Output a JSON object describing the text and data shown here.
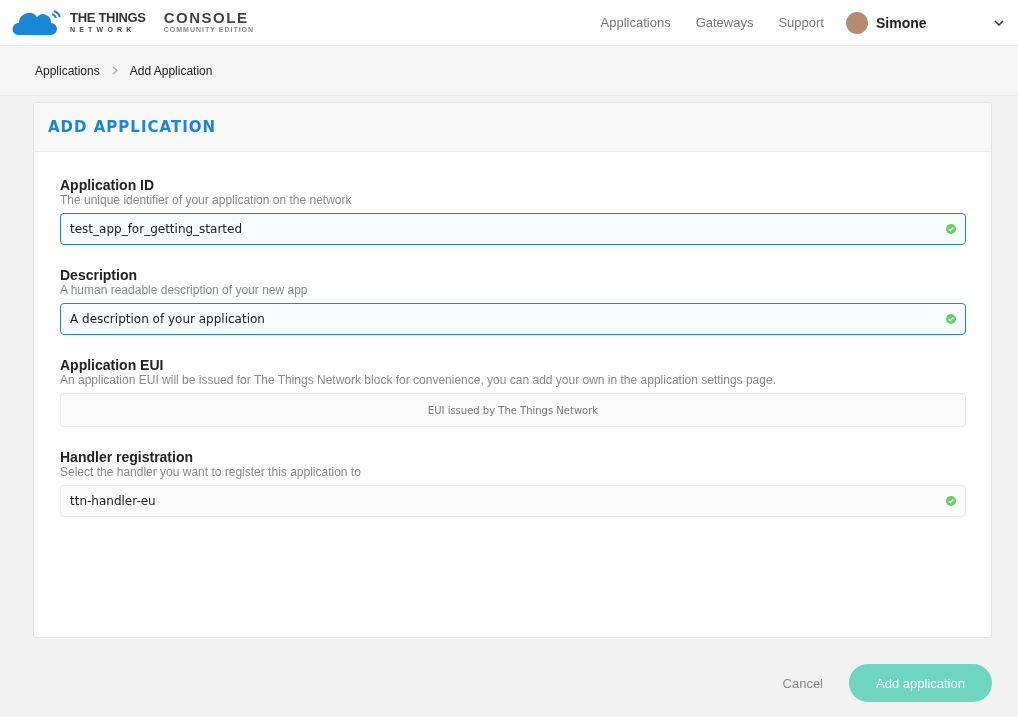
{
  "header": {
    "logo_title": "THE THINGS",
    "logo_subtitle": "NETWORK",
    "product": "CONSOLE",
    "edition": "COMMUNITY EDITION",
    "nav": [
      {
        "label": "Applications"
      },
      {
        "label": "Gateways"
      },
      {
        "label": "Support"
      }
    ],
    "user": {
      "name": "Simone"
    }
  },
  "breadcrumb": [
    {
      "label": "Applications"
    },
    {
      "label": "Add Application"
    }
  ],
  "card": {
    "title": "ADD APPLICATION",
    "fields": [
      {
        "kind": "input",
        "label": "Application ID",
        "hint": "The unique identifier of your application on the network",
        "value": "test_app_for_getting_started",
        "focused": true,
        "valid": true
      },
      {
        "kind": "input",
        "label": "Description",
        "hint": "A human readable description of your new app",
        "value": "A description of your application",
        "focused": true,
        "valid": true
      },
      {
        "kind": "static",
        "label": "Application EUI",
        "hint": "An application EUI will be issued for The Things Network block for convenience, you can add your own in the application settings page.",
        "placeholder": "EUI issued by The Things Network"
      },
      {
        "kind": "input",
        "label": "Handler registration",
        "hint": "Select the handler you want to register this application to",
        "value": "ttn-handler-eu",
        "focused": false,
        "valid": true
      }
    ]
  },
  "actions": {
    "cancel": "Cancel",
    "submit": "Add application"
  }
}
